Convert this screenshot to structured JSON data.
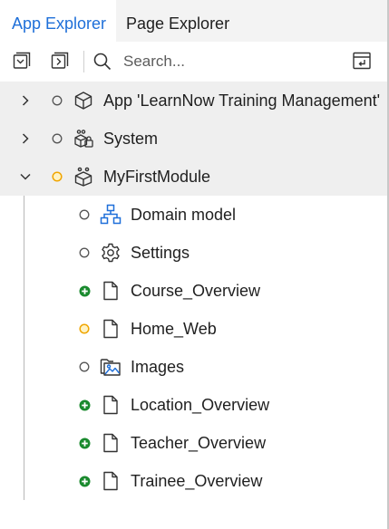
{
  "tabs": [
    {
      "label": "App Explorer",
      "active": true
    },
    {
      "label": "Page Explorer",
      "active": false
    }
  ],
  "toolbar": {
    "search_placeholder": "Search..."
  },
  "colors": {
    "accent": "#1e6fd9",
    "status_unchanged": "#555555",
    "status_modified": "#f0a500",
    "status_added": "#1a8a2e",
    "row_highlight": "#efefef"
  },
  "tree": {
    "top_items": [
      {
        "label": "App 'LearnNow Training Management'",
        "icon": "package-icon",
        "status": "unchanged",
        "expanded": false
      },
      {
        "label": "System",
        "icon": "system-module-icon",
        "status": "unchanged",
        "expanded": false
      },
      {
        "label": "MyFirstModule",
        "icon": "module-icon",
        "status": "modified",
        "expanded": true
      }
    ],
    "children": [
      {
        "label": "Domain model",
        "icon": "domain-model-icon",
        "status": "unchanged"
      },
      {
        "label": "Settings",
        "icon": "settings-icon",
        "status": "unchanged"
      },
      {
        "label": "Course_Overview",
        "icon": "page-icon",
        "status": "added"
      },
      {
        "label": "Home_Web",
        "icon": "page-icon",
        "status": "modified"
      },
      {
        "label": "Images",
        "icon": "images-icon",
        "status": "unchanged"
      },
      {
        "label": "Location_Overview",
        "icon": "page-icon",
        "status": "added"
      },
      {
        "label": "Teacher_Overview",
        "icon": "page-icon",
        "status": "added"
      },
      {
        "label": "Trainee_Overview",
        "icon": "page-icon",
        "status": "added"
      }
    ]
  }
}
